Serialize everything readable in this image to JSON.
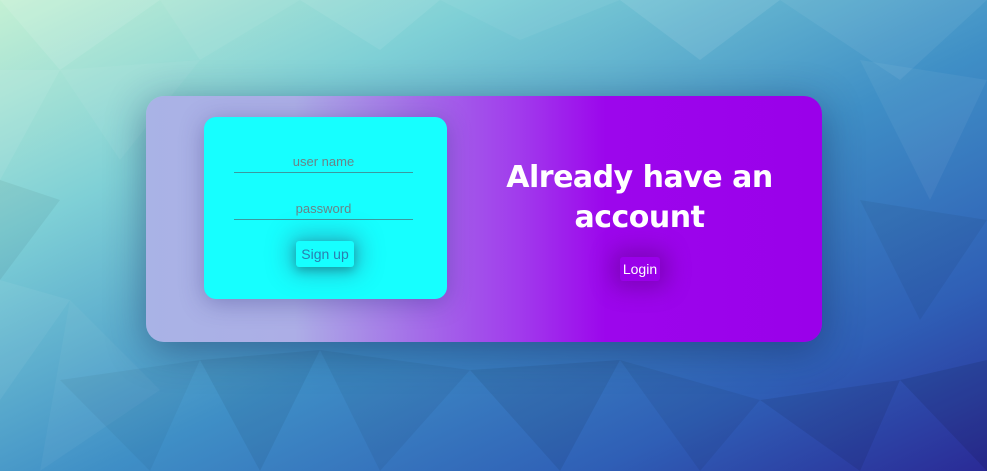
{
  "signup_form": {
    "username_placeholder": "user name",
    "password_placeholder": "password",
    "signup_label": "Sign up"
  },
  "login_panel": {
    "heading": "Already have an account",
    "login_label": "Login"
  },
  "colors": {
    "form_panel": "#16ffff",
    "card_accent": "#9a00ea",
    "card_start": "#a9b3e6"
  }
}
